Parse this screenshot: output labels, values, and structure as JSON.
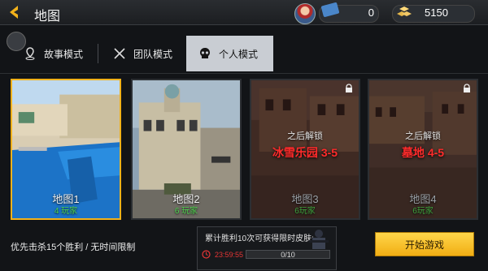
{
  "header": {
    "title": "地图",
    "tickets": "0",
    "gold": "5150"
  },
  "tabs": [
    {
      "label": "故事模式",
      "icon": "map-pin-icon",
      "active": false
    },
    {
      "label": "团队模式",
      "icon": "crossed-swords-icon",
      "active": false
    },
    {
      "label": "个人模式",
      "icon": "skull-mask-icon",
      "active": true
    }
  ],
  "maps": [
    {
      "name": "地图1",
      "players": "4 玩家",
      "locked": false,
      "selected": true
    },
    {
      "name": "地图2",
      "players": "6 玩家",
      "locked": false,
      "selected": false
    },
    {
      "name": "地图3",
      "players": "6玩家",
      "locked": true,
      "unlock_after": "之后解锁",
      "unlock_req": "冰雪乐园 3-5"
    },
    {
      "name": "地图4",
      "players": "6玩家",
      "locked": true,
      "unlock_after": "之后解锁",
      "unlock_req": "墓地 4-5"
    }
  ],
  "footer": {
    "rule": "优先击杀15个胜利 / 无时间限制",
    "reward_text": "累计胜利10次可获得限时皮肤:",
    "timer": "23:59:55",
    "progress_text": "0/10",
    "progress": 0,
    "start_label": "开始游戏"
  },
  "colors": {
    "accent": "#f2b21b",
    "locked_text": "#ff2b2b",
    "players": "#4fd44f"
  }
}
